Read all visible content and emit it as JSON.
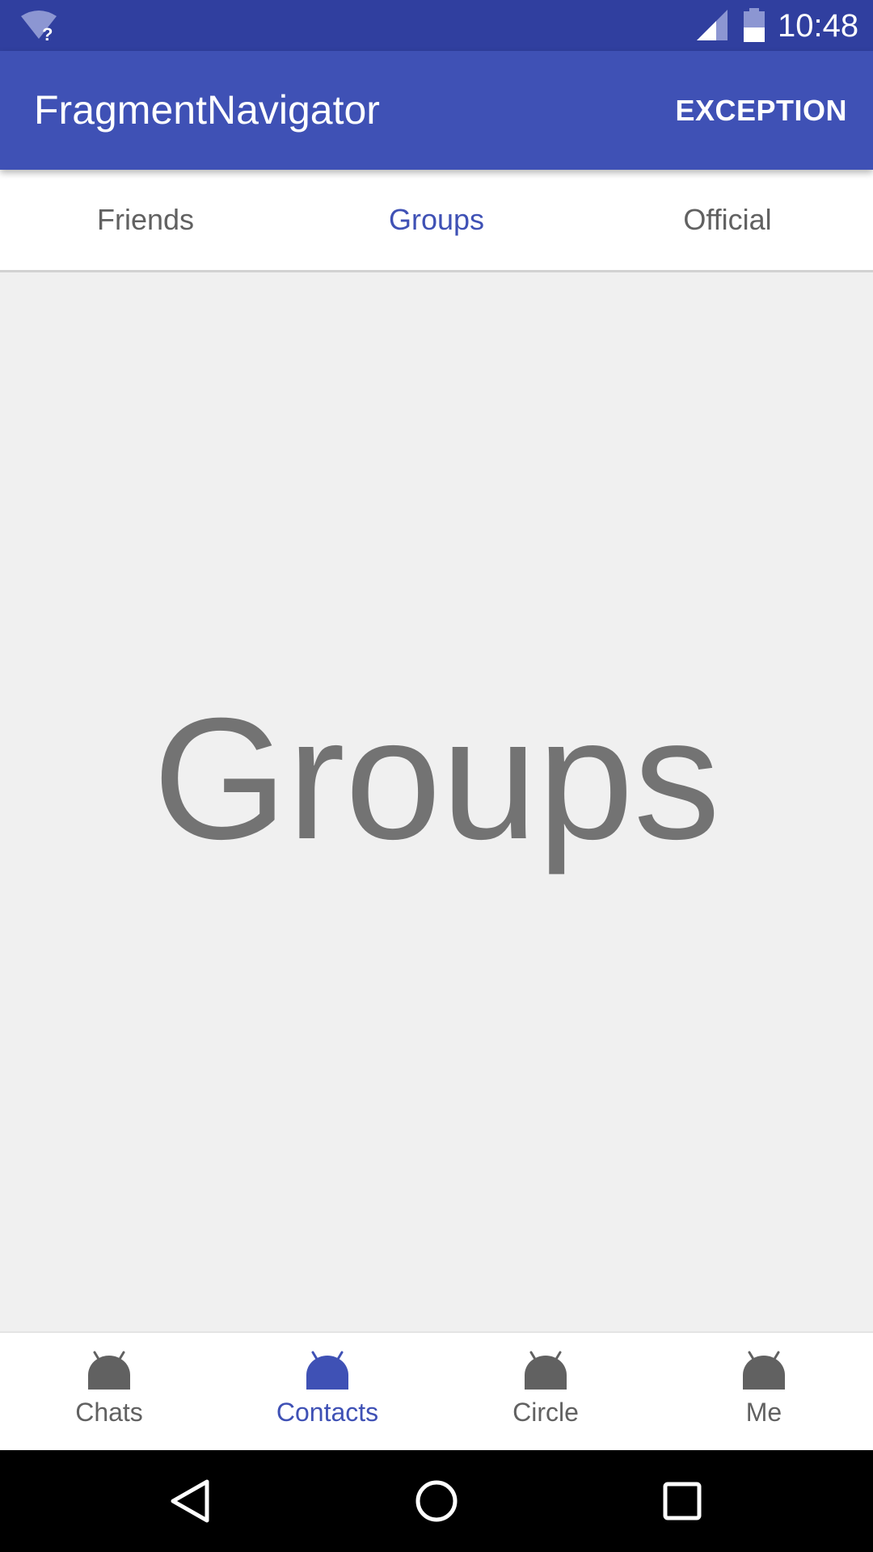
{
  "status_bar": {
    "time": "10:48",
    "icons": [
      "wifi-question-icon",
      "cell-signal-icon",
      "battery-icon"
    ]
  },
  "app_bar": {
    "title": "FragmentNavigator",
    "action_label": "EXCEPTION",
    "color": "#3f51b5"
  },
  "top_tabs": [
    {
      "label": "Friends",
      "active": false
    },
    {
      "label": "Groups",
      "active": true
    },
    {
      "label": "Official",
      "active": false
    }
  ],
  "content": {
    "label": "Groups"
  },
  "bottom_nav": [
    {
      "label": "Chats",
      "icon": "android-head-icon",
      "active": false
    },
    {
      "label": "Contacts",
      "icon": "android-head-icon",
      "active": true
    },
    {
      "label": "Circle",
      "icon": "android-head-icon",
      "active": false
    },
    {
      "label": "Me",
      "icon": "android-head-icon",
      "active": false
    }
  ],
  "system_nav": {
    "icons": [
      "back-icon",
      "home-icon",
      "recents-icon"
    ]
  },
  "colors": {
    "primary": "#3f51b5",
    "primary_dark": "#303f9f",
    "inactive_text": "#616161",
    "content_text": "#737373"
  }
}
